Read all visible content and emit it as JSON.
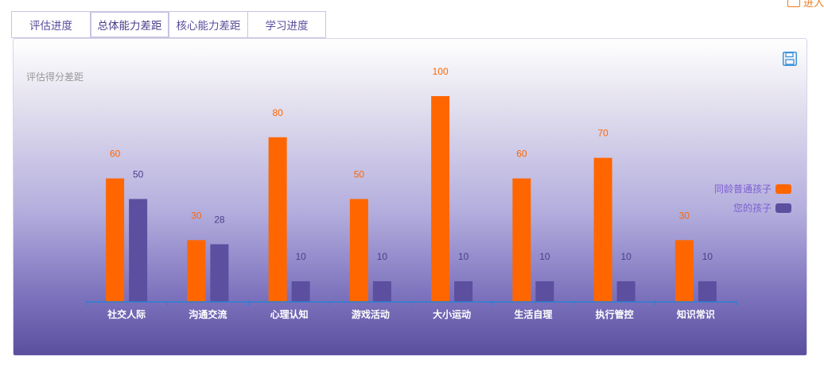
{
  "header": {
    "link_label": "进入"
  },
  "tabs": [
    {
      "label": "评估进度",
      "active": false
    },
    {
      "label": "总体能力差距",
      "active": true
    },
    {
      "label": "核心能力差距",
      "active": false
    },
    {
      "label": "学习进度",
      "active": false
    }
  ],
  "toolbar": {
    "save_icon": "save-icon"
  },
  "chart_data": {
    "type": "bar",
    "title": "评估得分差距",
    "categories": [
      "社交人际",
      "沟通交流",
      "心理认知",
      "游戏活动",
      "大小运动",
      "生活自理",
      "执行管控",
      "知识常识"
    ],
    "series": [
      {
        "name": "同龄普通孩子",
        "color": "#ff6600",
        "values": [
          60,
          30,
          80,
          50,
          100,
          60,
          70,
          30
        ]
      },
      {
        "name": "您的孩子",
        "color": "#5c4f9f",
        "values": [
          50,
          28,
          10,
          10,
          10,
          10,
          10,
          10
        ]
      }
    ],
    "ylim": [
      0,
      100
    ],
    "grid": false,
    "legend_position": "right",
    "colors": {
      "axis": "#2a7fd4",
      "label_series1": "#ff6600",
      "label_series2": "#4a3d8a",
      "legend_text": "#7a5fd0",
      "title": "#999999"
    }
  }
}
